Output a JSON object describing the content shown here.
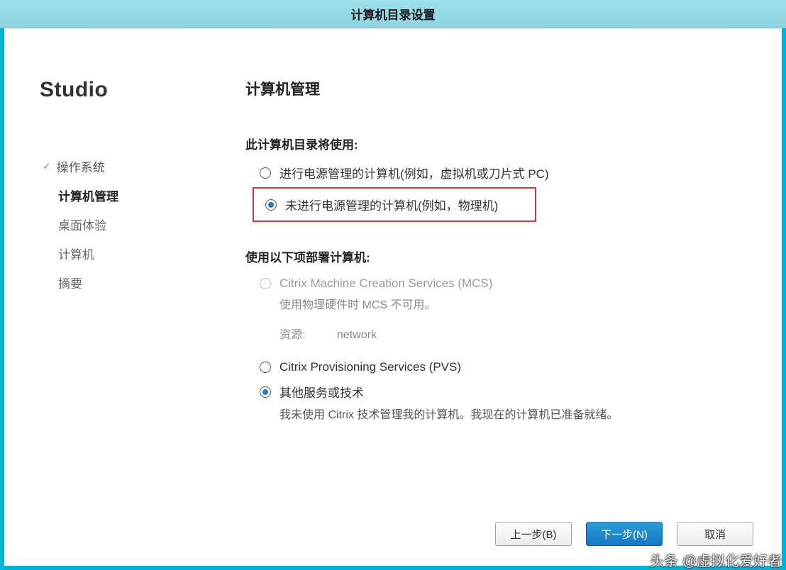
{
  "window": {
    "title": "计算机目录设置"
  },
  "brand": "Studio",
  "nav": [
    {
      "label": "操作系统",
      "state": "completed"
    },
    {
      "label": "计算机管理",
      "state": "active"
    },
    {
      "label": "桌面体验",
      "state": ""
    },
    {
      "label": "计算机",
      "state": ""
    },
    {
      "label": "摘要",
      "state": ""
    }
  ],
  "main": {
    "title": "计算机管理",
    "section1_label": "此计算机目录将使用:",
    "opt_managed": "进行电源管理的计算机(例如，虚拟机或刀片式 PC)",
    "opt_unmanaged": "未进行电源管理的计算机(例如，物理机)",
    "section2_label": "使用以下项部署计算机:",
    "opt_mcs": "Citrix Machine Creation Services (MCS)",
    "mcs_note": "使用物理硬件时 MCS 不可用。",
    "res_label": "资源:",
    "res_value": "network",
    "opt_pvs": "Citrix Provisioning Services (PVS)",
    "opt_other": "其他服务或技术",
    "other_note": "我未使用 Citrix 技术管理我的计算机。我现在的计算机已准备就绪。"
  },
  "buttons": {
    "back": "上一步(B)",
    "next": "下一步(N)",
    "cancel": "取消"
  },
  "watermark": "头条 @虚拟化爱好者"
}
